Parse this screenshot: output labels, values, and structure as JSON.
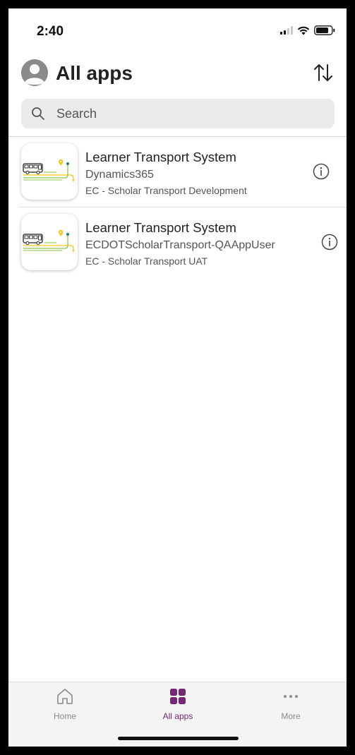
{
  "status": {
    "time": "2:40"
  },
  "header": {
    "title": "All apps"
  },
  "search": {
    "placeholder": "Search",
    "value": ""
  },
  "apps": [
    {
      "name": "Learner Transport System",
      "org": "Dynamics365",
      "environment": "EC - Scholar Transport Development"
    },
    {
      "name": "Learner Transport System",
      "org": "ECDOTScholarTransport-QAAppUser",
      "environment": "EC - Scholar Transport UAT"
    }
  ],
  "nav": {
    "home": "Home",
    "all_apps": "All apps",
    "more": "More",
    "active": "all_apps"
  },
  "colors": {
    "accent": "#742774",
    "route_green": "#8bc34a",
    "route_yellow": "#f5c518",
    "pin_teal": "#2f7d6d"
  },
  "icons": [
    "person-icon",
    "sort-icon",
    "search-icon",
    "bus-route-icon",
    "info-icon",
    "home-icon",
    "grid-icon",
    "more-icon",
    "signal-icon",
    "wifi-icon",
    "battery-icon"
  ]
}
